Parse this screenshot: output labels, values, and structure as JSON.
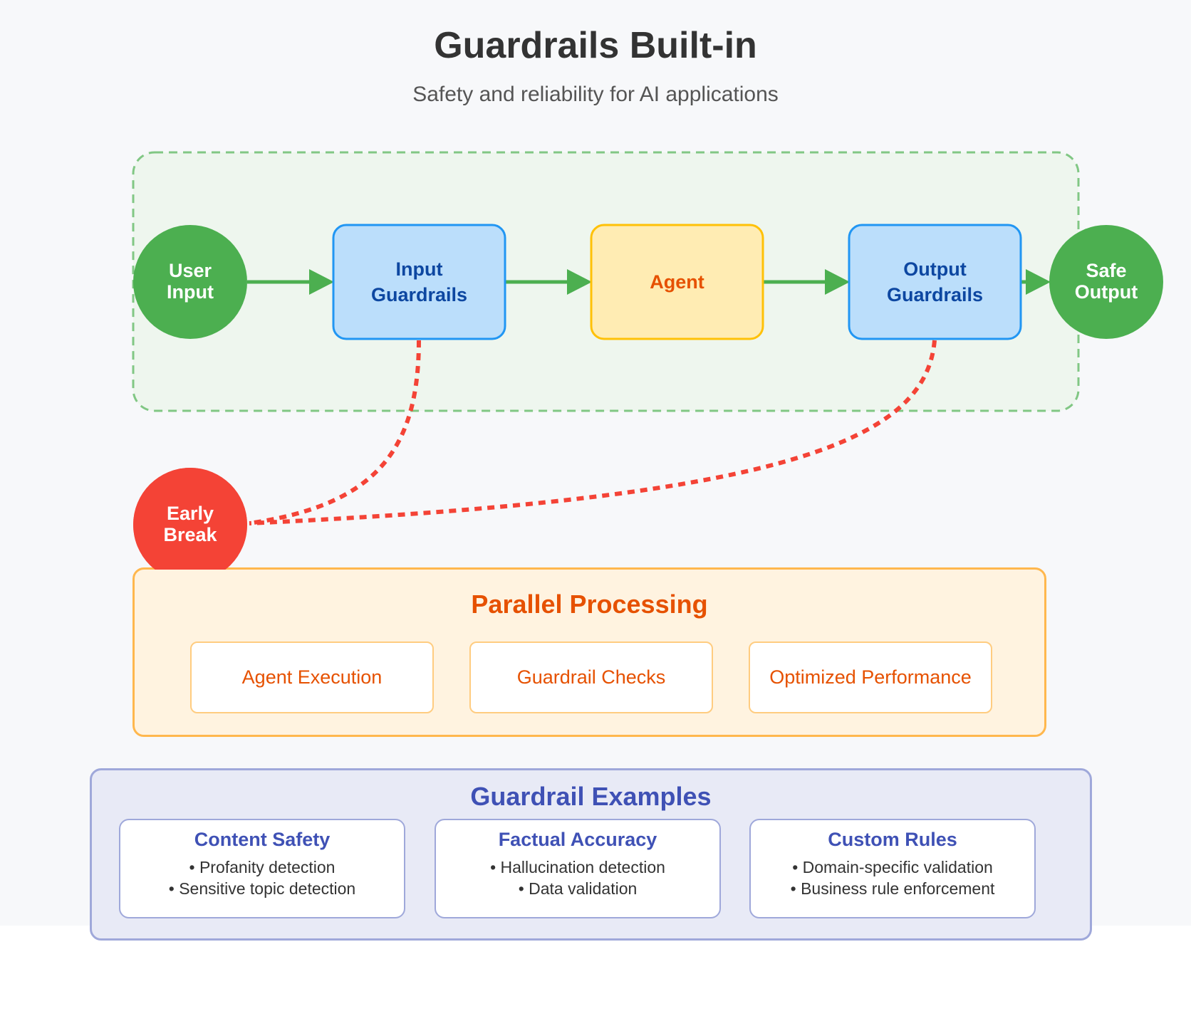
{
  "header": {
    "title": "Guardrails Built-in",
    "subtitle": "Safety and reliability for AI applications"
  },
  "flow": {
    "nodes": [
      {
        "id": "user-input",
        "shape": "circle",
        "lines": [
          "User",
          "Input"
        ],
        "fill": "#4caf50",
        "text_color": "#ffffff"
      },
      {
        "id": "input-guardrails",
        "shape": "box",
        "lines": [
          "Input",
          "Guardrails"
        ],
        "fill": "#bbdefb",
        "stroke": "#2196f3",
        "text_color": "#0d47a1"
      },
      {
        "id": "agent",
        "shape": "box",
        "lines": [
          "Agent"
        ],
        "fill": "#ffecb3",
        "stroke": "#ffc107",
        "text_color": "#e65100"
      },
      {
        "id": "output-guardrails",
        "shape": "box",
        "lines": [
          "Output",
          "Guardrails"
        ],
        "fill": "#bbdefb",
        "stroke": "#2196f3",
        "text_color": "#0d47a1"
      },
      {
        "id": "safe-output",
        "shape": "circle",
        "lines": [
          "Safe",
          "Output"
        ],
        "fill": "#4caf50",
        "text_color": "#ffffff"
      },
      {
        "id": "early-break",
        "shape": "circle",
        "lines": [
          "Early",
          "Break"
        ],
        "fill": "#f44336",
        "text_color": "#ffffff"
      }
    ],
    "edges": [
      {
        "from": "user-input",
        "to": "input-guardrails",
        "style": "solid",
        "color": "#4caf50"
      },
      {
        "from": "input-guardrails",
        "to": "agent",
        "style": "solid",
        "color": "#4caf50"
      },
      {
        "from": "agent",
        "to": "output-guardrails",
        "style": "solid",
        "color": "#4caf50"
      },
      {
        "from": "output-guardrails",
        "to": "safe-output",
        "style": "solid",
        "color": "#4caf50"
      },
      {
        "from": "input-guardrails",
        "to": "early-break",
        "style": "dotted",
        "color": "#f44336"
      },
      {
        "from": "output-guardrails",
        "to": "early-break",
        "style": "dotted",
        "color": "#f44336"
      }
    ],
    "group_border_color": "#81c784",
    "group_fill": "#eef6ee"
  },
  "parallel": {
    "title": "Parallel Processing",
    "items": [
      "Agent Execution",
      "Guardrail Checks",
      "Optimized Performance"
    ]
  },
  "examples": {
    "title": "Guardrail Examples",
    "cards": [
      {
        "title": "Content Safety",
        "items": [
          "• Profanity detection",
          "• Sensitive topic detection"
        ]
      },
      {
        "title": "Factual Accuracy",
        "items": [
          "• Hallucination detection",
          "• Data validation"
        ]
      },
      {
        "title": "Custom Rules",
        "items": [
          "• Domain-specific validation",
          "• Business rule enforcement"
        ]
      }
    ]
  }
}
